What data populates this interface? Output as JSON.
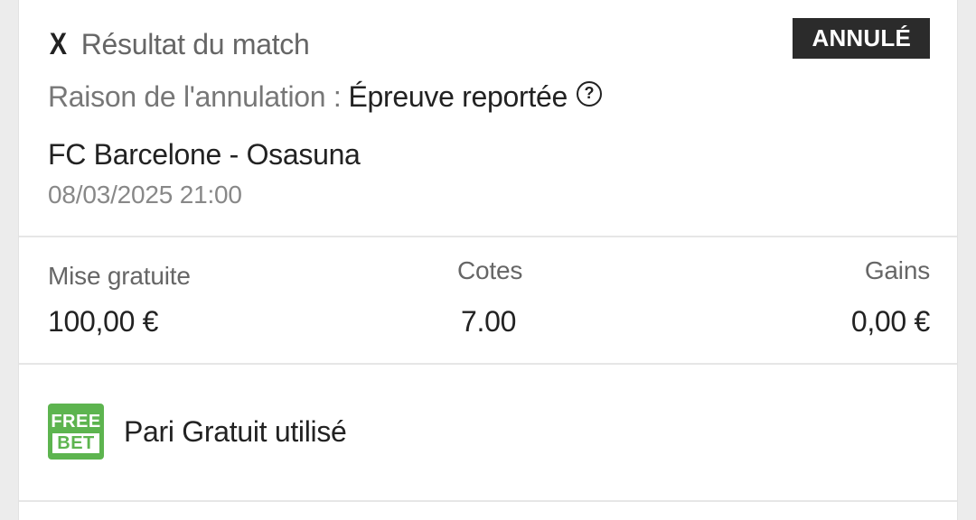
{
  "bet": {
    "market_marker": "X",
    "market_title": "Résultat du match",
    "status": "ANNULÉ",
    "reason_label": "Raison de l'annulation :",
    "reason_value": "Épreuve reportée",
    "match": "FC Barcelone - Osasuna",
    "date": "08/03/2025 21:00"
  },
  "stats": {
    "stake_label": "Mise gratuite",
    "stake_value": "100,00 €",
    "odds_label": "Cotes",
    "odds_value": "7.00",
    "gains_label": "Gains",
    "gains_value": "0,00 €"
  },
  "freebet": {
    "icon_top": "FREE",
    "icon_bottom": "BET",
    "label": "Pari Gratuit utilisé"
  },
  "icons": {
    "help": "question-circle-icon",
    "freebet": "free-bet-icon"
  },
  "colors": {
    "badge_bg": "#2b2b2b",
    "freebet_green": "#5db44f"
  }
}
